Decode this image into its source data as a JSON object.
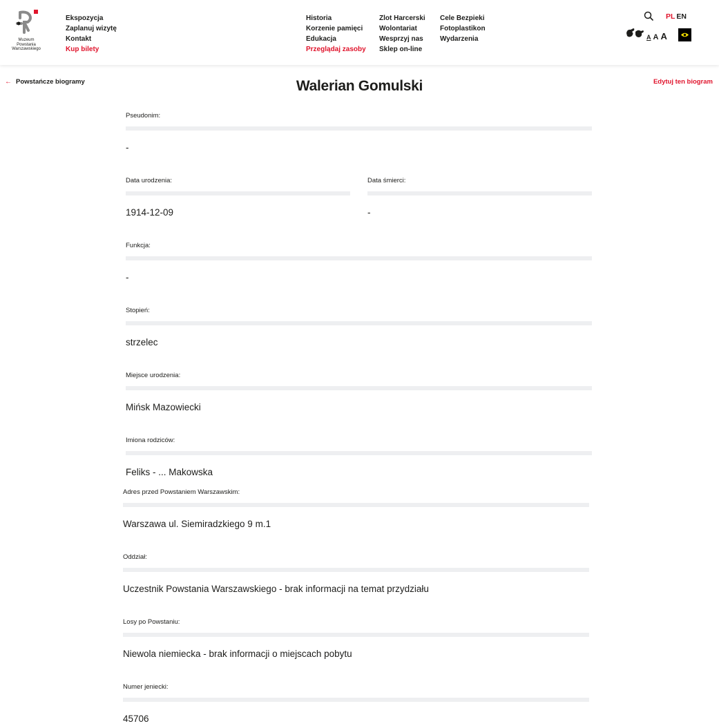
{
  "logo": {
    "line1": "Muzeum",
    "line2": "Powstania",
    "line3": "Warszawskiego"
  },
  "nav": {
    "col1": [
      "Ekspozycja",
      "Zaplanuj wizytę",
      "Kontakt",
      "Kup bilety"
    ],
    "col2": [
      "Historia",
      "Korzenie pamięci",
      "Edukacja",
      "Przeglądaj zasoby"
    ],
    "col3": [
      "Zlot Harcerski",
      "Wolontariat",
      "Wesprzyj nas",
      "Sklep on-line"
    ],
    "col4": [
      "Cele Bezpieki",
      "Fotoplastikon",
      "Wydarzenia"
    ]
  },
  "tools": {
    "search_icon": "search-icon",
    "lang_pl": "PL",
    "lang_en": "EN",
    "sign_language_icon": "sign-language-icon",
    "font_small": "A",
    "font_medium": "A",
    "font_large": "A",
    "contrast_icon": "eye-icon"
  },
  "page": {
    "back_label": "Powstańcze biogramy",
    "title": "Walerian Gomulski",
    "edit_label": "Edytuj ten biogram"
  },
  "fields": {
    "pseudonim": {
      "label": "Pseudonim:",
      "value": "-"
    },
    "data_urodzenia": {
      "label": "Data urodzenia:",
      "value": "1914-12-09"
    },
    "data_smierci": {
      "label": "Data śmierci:",
      "value": "-"
    },
    "funkcja": {
      "label": "Funkcja:",
      "value": "-"
    },
    "stopien": {
      "label": "Stopień:",
      "value": "strzelec"
    },
    "miejsce_urodzenia": {
      "label": "Miejsce urodzenia:",
      "value": "Mińsk Mazowiecki"
    },
    "imiona_rodzicow": {
      "label": "Imiona rodziców:",
      "value": "Feliks - ... Makowska"
    },
    "adres": {
      "label": "Adres przed Powstaniem Warszawskim:",
      "value": "Warszawa ul. Siemiradzkiego 9 m.1"
    },
    "oddzial": {
      "label": "Oddział:",
      "value": "Uczestnik Powstania Warszawskiego - brak informacji na temat przydziału"
    },
    "losy": {
      "label": "Losy po Powstaniu:",
      "value": "Niewola niemiecka - brak informacji o miejscach pobytu"
    },
    "numer_jeniecki": {
      "label": "Numer jeniecki:",
      "value": "45706"
    }
  },
  "colors": {
    "accent": "#e0142c",
    "text": "#1d1d1b",
    "field_bar": "#eeeff1"
  }
}
